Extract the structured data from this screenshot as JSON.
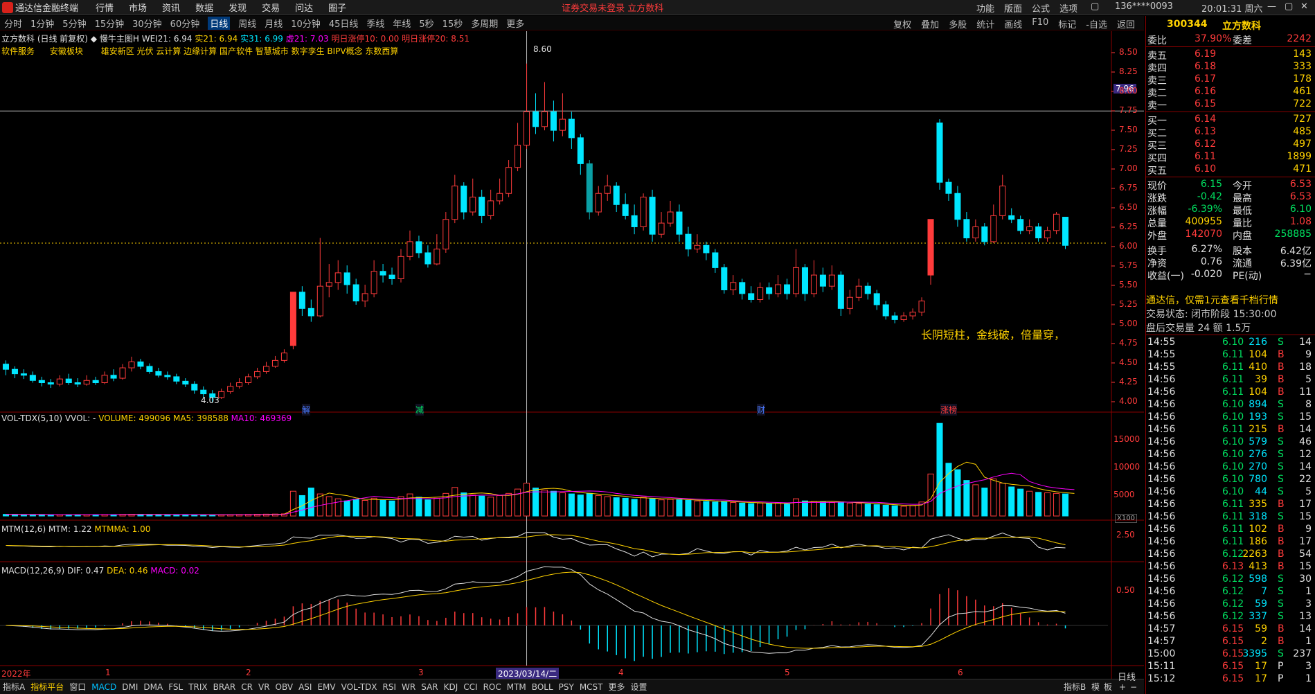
{
  "window": {
    "title": "通达信金融终端",
    "menu": [
      "行情",
      "市场",
      "资讯",
      "数据",
      "发现",
      "交易",
      "问达",
      "圈子"
    ],
    "notice": "证券交易未登录  立方数科",
    "right_menu": [
      "功能",
      "版面",
      "公式",
      "选项"
    ],
    "account": "136****0093",
    "clock": "20:01:31 周六"
  },
  "periods": [
    "分时",
    "1分钟",
    "5分钟",
    "15分钟",
    "30分钟",
    "60分钟",
    "日线",
    "周线",
    "月线",
    "10分钟",
    "45日线",
    "季线",
    "年线",
    "5秒",
    "15秒",
    "多周期",
    "更多"
  ],
  "active_period": "日线",
  "tools": [
    "复权",
    "叠加",
    "多股",
    "统计",
    "画线",
    "F10",
    "标记",
    "-自选",
    "返回"
  ],
  "main": {
    "legend": [
      {
        "t": "立方数科 (日线 前复权)",
        "c": "#e0e0e0"
      },
      {
        "t": "◆ 慢牛主图H",
        "c": "#e0e0e0"
      },
      {
        "t": "WEI21: 6.94",
        "c": "#e0e0e0"
      },
      {
        "t": "实21: 6.94",
        "c": "#ffd200"
      },
      {
        "t": "实31: 6.99",
        "c": "#00e6ff"
      },
      {
        "t": "虚21: 7.03",
        "c": "#ff00ff"
      },
      {
        "t": "明日涨停10: 0.00",
        "c": "#ff3b3b"
      },
      {
        "t": "明日涨停20: 8.51",
        "c": "#ff3b3b"
      }
    ],
    "tags_left": [
      "软件服务",
      "安徽板块"
    ],
    "tags": "雄安新区 光伏 云计算 边缘计算 国产软件 智慧城市 数字孪生 BIPV概念 东数西算",
    "crosshair_price": "7.96",
    "hi_label": "8.60",
    "lo_label": "4.03",
    "annotation": "长阴短柱，金线破，倍量穿，",
    "events": [
      "解",
      "减",
      "财",
      "涨榜"
    ]
  },
  "price_axis": [
    "8.50",
    "8.25",
    "8.00",
    "7.75",
    "7.50",
    "7.25",
    "7.00",
    "6.75",
    "6.50",
    "6.25",
    "6.00",
    "5.75",
    "5.50",
    "5.25",
    "5.00",
    "4.75",
    "4.50",
    "4.25",
    "4.00"
  ],
  "vol": {
    "legend": [
      {
        "t": "VOL-TDX(5,10)",
        "c": "#e0e0e0"
      },
      {
        "t": "VVOL: -",
        "c": "#e0e0e0"
      },
      {
        "t": "VOLUME: 499096",
        "c": "#ffd200"
      },
      {
        "t": "MA5: 398588",
        "c": "#ffd200"
      },
      {
        "t": "MA10: 469369",
        "c": "#ff00ff"
      }
    ],
    "axis": [
      "15000",
      "10000",
      "5000"
    ],
    "unit": "X100"
  },
  "mtm": {
    "legend": [
      {
        "t": "MTM(12,6)",
        "c": "#e0e0e0"
      },
      {
        "t": "MTM: 1.22",
        "c": "#e0e0e0"
      },
      {
        "t": "MTMMA: 1.00",
        "c": "#ffd200"
      }
    ],
    "axis": [
      "2.50"
    ]
  },
  "macd": {
    "legend": [
      {
        "t": "MACD(12,26,9)",
        "c": "#e0e0e0"
      },
      {
        "t": "DIF: 0.47",
        "c": "#e0e0e0"
      },
      {
        "t": "DEA: 0.46",
        "c": "#ffd200"
      },
      {
        "t": "MACD: 0.02",
        "c": "#ff00ff"
      }
    ],
    "axis": [
      "0.50"
    ]
  },
  "date_axis": [
    {
      "t": "2022年"
    },
    {
      "t": "1"
    },
    {
      "t": "2"
    },
    {
      "t": "3"
    },
    {
      "t": "2023/03/14/二"
    },
    {
      "t": "4"
    },
    {
      "t": "5"
    },
    {
      "t": "6"
    }
  ],
  "bottom_tabs": [
    "指标A",
    "指标平台",
    "窗口",
    "MACD",
    "DMI",
    "DMA",
    "FSL",
    "TRIX",
    "BRAR",
    "CR",
    "VR",
    "OBV",
    "ASI",
    "EMV",
    "VOL-TDX",
    "RSI",
    "WR",
    "SAR",
    "KDJ",
    "CCI",
    "ROC",
    "MTM",
    "BOLL",
    "PSY",
    "MCST",
    "更多",
    "设置"
  ],
  "active_tab": "MACD",
  "bottom_right": [
    "日线",
    "指标B",
    "模",
    "板"
  ],
  "quote": {
    "code": "300344",
    "name": "立方数科",
    "wb": "37.90%",
    "wc": "2242",
    "asks": [
      {
        "n": "卖五",
        "p": "6.19",
        "v": "143"
      },
      {
        "n": "卖四",
        "p": "6.18",
        "v": "333"
      },
      {
        "n": "卖三",
        "p": "6.17",
        "v": "178"
      },
      {
        "n": "卖二",
        "p": "6.16",
        "v": "461"
      },
      {
        "n": "卖一",
        "p": "6.15",
        "v": "722"
      }
    ],
    "bids": [
      {
        "n": "买一",
        "p": "6.14",
        "v": "727"
      },
      {
        "n": "买二",
        "p": "6.13",
        "v": "485"
      },
      {
        "n": "买三",
        "p": "6.12",
        "v": "497"
      },
      {
        "n": "买四",
        "p": "6.11",
        "v": "1899"
      },
      {
        "n": "买五",
        "p": "6.10",
        "v": "471"
      }
    ],
    "stats": [
      {
        "a": "现价",
        "b": "6.15",
        "bc": "grn",
        "c": "今开",
        "d": "6.53",
        "dc": "red"
      },
      {
        "a": "涨跌",
        "b": "-0.42",
        "bc": "grn",
        "c": "最高",
        "d": "6.53",
        "dc": "red"
      },
      {
        "a": "涨幅",
        "b": "-6.39%",
        "bc": "grn",
        "c": "最低",
        "d": "6.10",
        "dc": "grn"
      },
      {
        "a": "总量",
        "b": "400955",
        "bc": "yel",
        "c": "量比",
        "d": "1.08",
        "dc": "red"
      },
      {
        "a": "外盘",
        "b": "142070",
        "bc": "red",
        "c": "内盘",
        "d": "258885",
        "dc": "grn"
      },
      {
        "a": "换手",
        "b": "6.27%",
        "bc": "wht",
        "c": "股本",
        "d": "6.42亿",
        "dc": "wht"
      },
      {
        "a": "净资",
        "b": "0.76",
        "bc": "wht",
        "c": "流通",
        "d": "6.39亿",
        "dc": "wht"
      },
      {
        "a": "收益(一)",
        "b": "-0.020",
        "bc": "wht",
        "c": "PE(动)",
        "d": "−",
        "dc": "wht"
      }
    ],
    "ad": "通达信，仅需1元查看千档行情",
    "status": "交易状态: 闭市阶段 15:30:00",
    "after": "盘后交易量 24 额 1.5万",
    "ticks": [
      [
        "14:55",
        "6.10",
        "216",
        "S",
        "14"
      ],
      [
        "14:55",
        "6.11",
        "104",
        "B",
        "9"
      ],
      [
        "14:55",
        "6.11",
        "410",
        "B",
        "18"
      ],
      [
        "14:56",
        "6.11",
        "39",
        "B",
        "5"
      ],
      [
        "14:56",
        "6.11",
        "104",
        "B",
        "11"
      ],
      [
        "14:56",
        "6.10",
        "894",
        "S",
        "8"
      ],
      [
        "14:56",
        "6.10",
        "193",
        "S",
        "15"
      ],
      [
        "14:56",
        "6.11",
        "215",
        "B",
        "14"
      ],
      [
        "14:56",
        "6.10",
        "579",
        "S",
        "46"
      ],
      [
        "14:56",
        "6.10",
        "276",
        "S",
        "12"
      ],
      [
        "14:56",
        "6.10",
        "270",
        "S",
        "14"
      ],
      [
        "14:56",
        "6.10",
        "780",
        "S",
        "22"
      ],
      [
        "14:56",
        "6.10",
        "44",
        "S",
        "5"
      ],
      [
        "14:56",
        "6.11",
        "335",
        "B",
        "17"
      ],
      [
        "14:56",
        "6.11",
        "318",
        "S",
        "15"
      ],
      [
        "14:56",
        "6.11",
        "102",
        "B",
        "9"
      ],
      [
        "14:56",
        "6.11",
        "186",
        "B",
        "17"
      ],
      [
        "14:56",
        "6.12",
        "2263",
        "B",
        "54"
      ],
      [
        "14:56",
        "6.13",
        "413",
        "B",
        "15"
      ],
      [
        "14:56",
        "6.12",
        "598",
        "S",
        "30"
      ],
      [
        "14:56",
        "6.12",
        "7",
        "S",
        "1"
      ],
      [
        "14:56",
        "6.12",
        "59",
        "S",
        "3"
      ],
      [
        "14:56",
        "6.12",
        "337",
        "S",
        "13"
      ],
      [
        "14:57",
        "6.15",
        "59",
        "B",
        "14"
      ],
      [
        "14:57",
        "6.15",
        "2",
        "B",
        "1"
      ],
      [
        "15:00",
        "6.15",
        "3395",
        "S",
        "237"
      ],
      [
        "15:11",
        "6.15",
        "17",
        "P",
        "3"
      ],
      [
        "15:12",
        "6.15",
        "17",
        "P",
        "1"
      ]
    ]
  },
  "chart_data": {
    "type": "candlestick",
    "x_range": [
      "2022年12月",
      "2023年6月"
    ],
    "y_range": [
      4.0,
      8.6
    ],
    "high": 8.6,
    "low": 4.03,
    "candles": [
      [
        4.55,
        4.48,
        4.6,
        4.4
      ],
      [
        4.48,
        4.42,
        4.52,
        4.36
      ],
      [
        4.42,
        4.4,
        4.48,
        4.35
      ],
      [
        4.4,
        4.33,
        4.45,
        4.3
      ],
      [
        4.33,
        4.3,
        4.38,
        4.25
      ],
      [
        4.3,
        4.28,
        4.35,
        4.23
      ],
      [
        4.28,
        4.35,
        4.4,
        4.25
      ],
      [
        4.35,
        4.3,
        4.42,
        4.27
      ],
      [
        4.3,
        4.28,
        4.36,
        4.24
      ],
      [
        4.28,
        4.33,
        4.4,
        4.26
      ],
      [
        4.33,
        4.3,
        4.38,
        4.27
      ],
      [
        4.3,
        4.4,
        4.45,
        4.28
      ],
      [
        4.4,
        4.36,
        4.48,
        4.32
      ],
      [
        4.36,
        4.5,
        4.55,
        4.34
      ],
      [
        4.5,
        4.58,
        4.65,
        4.45
      ],
      [
        4.58,
        4.52,
        4.62,
        4.48
      ],
      [
        4.52,
        4.45,
        4.56,
        4.42
      ],
      [
        4.45,
        4.4,
        4.5,
        4.37
      ],
      [
        4.4,
        4.38,
        4.45,
        4.34
      ],
      [
        4.38,
        4.32,
        4.42,
        4.28
      ],
      [
        4.32,
        4.28,
        4.36,
        4.24
      ],
      [
        4.28,
        4.2,
        4.32,
        4.15
      ],
      [
        4.2,
        4.15,
        4.25,
        4.1
      ],
      [
        4.15,
        4.1,
        4.2,
        4.03
      ],
      [
        4.1,
        4.18,
        4.22,
        4.08
      ],
      [
        4.18,
        4.25,
        4.3,
        4.15
      ],
      [
        4.25,
        4.3,
        4.36,
        4.22
      ],
      [
        4.3,
        4.38,
        4.42,
        4.27
      ],
      [
        4.38,
        4.45,
        4.5,
        4.35
      ],
      [
        4.45,
        4.52,
        4.58,
        4.42
      ],
      [
        4.52,
        4.6,
        4.66,
        4.5
      ],
      [
        4.6,
        4.7,
        4.75,
        4.57
      ],
      [
        4.8,
        5.52,
        5.52,
        4.75
      ],
      [
        5.52,
        5.3,
        5.6,
        5.2
      ],
      [
        5.3,
        5.2,
        5.42,
        5.12
      ],
      [
        5.2,
        5.6,
        6.25,
        5.18
      ],
      [
        5.6,
        5.65,
        5.9,
        5.45
      ],
      [
        5.65,
        5.78,
        5.95,
        5.55
      ],
      [
        5.78,
        5.62,
        5.88,
        5.5
      ],
      [
        5.62,
        5.4,
        5.7,
        5.35
      ],
      [
        5.4,
        5.5,
        5.62,
        5.32
      ],
      [
        5.5,
        5.8,
        5.95,
        5.45
      ],
      [
        5.8,
        5.75,
        5.9,
        5.65
      ],
      [
        5.75,
        5.7,
        5.85,
        5.62
      ],
      [
        5.7,
        6.0,
        6.1,
        5.65
      ],
      [
        6.0,
        6.2,
        6.35,
        5.95
      ],
      [
        6.2,
        6.05,
        6.28,
        5.98
      ],
      [
        6.05,
        5.9,
        6.15,
        5.85
      ],
      [
        5.9,
        6.1,
        6.3,
        5.88
      ],
      [
        6.1,
        6.5,
        6.6,
        6.05
      ],
      [
        6.5,
        6.95,
        7.1,
        6.45
      ],
      [
        6.95,
        6.6,
        7.0,
        6.5
      ],
      [
        6.6,
        6.8,
        7.05,
        6.55
      ],
      [
        6.8,
        6.55,
        6.9,
        6.45
      ],
      [
        6.55,
        6.75,
        6.9,
        6.5
      ],
      [
        6.75,
        6.85,
        7.05,
        6.7
      ],
      [
        6.85,
        7.2,
        7.3,
        6.8
      ],
      [
        7.2,
        7.5,
        7.8,
        7.15
      ],
      [
        7.5,
        7.95,
        8.6,
        7.45
      ],
      [
        7.95,
        7.75,
        8.2,
        7.65
      ],
      [
        7.75,
        7.95,
        8.35,
        7.7
      ],
      [
        7.95,
        7.7,
        8.1,
        7.55
      ],
      [
        7.7,
        7.85,
        8.2,
        7.62
      ],
      [
        7.85,
        7.6,
        7.95,
        7.45
      ],
      [
        7.6,
        7.25,
        7.65,
        7.1
      ],
      [
        7.25,
        6.6,
        7.3,
        6.5
      ],
      [
        6.6,
        6.85,
        6.95,
        6.55
      ],
      [
        6.85,
        6.95,
        7.1,
        6.75
      ],
      [
        6.95,
        6.7,
        7.0,
        6.6
      ],
      [
        6.7,
        6.55,
        6.85,
        6.5
      ],
      [
        6.55,
        6.4,
        6.7,
        6.3
      ],
      [
        6.4,
        6.8,
        6.85,
        6.35
      ],
      [
        6.8,
        6.3,
        6.9,
        6.2
      ],
      [
        6.3,
        6.45,
        6.6,
        6.25
      ],
      [
        6.45,
        6.6,
        6.75,
        6.4
      ],
      [
        6.6,
        6.3,
        6.7,
        6.2
      ],
      [
        6.3,
        6.1,
        6.4,
        6.0
      ],
      [
        6.1,
        6.15,
        6.3,
        6.05
      ],
      [
        6.15,
        6.05,
        6.2,
        5.95
      ],
      [
        6.05,
        5.85,
        6.1,
        5.78
      ],
      [
        5.85,
        5.55,
        5.9,
        5.5
      ],
      [
        5.55,
        5.65,
        5.75,
        5.48
      ],
      [
        5.65,
        5.5,
        5.7,
        5.42
      ],
      [
        5.5,
        5.42,
        5.6,
        5.38
      ],
      [
        5.42,
        5.58,
        5.65,
        5.38
      ],
      [
        5.58,
        5.5,
        5.65,
        5.42
      ],
      [
        5.5,
        5.62,
        5.75,
        5.45
      ],
      [
        5.62,
        5.5,
        5.7,
        5.42
      ],
      [
        5.5,
        5.85,
        6.1,
        5.45
      ],
      [
        5.85,
        5.5,
        5.9,
        5.4
      ],
      [
        5.5,
        5.75,
        5.95,
        5.45
      ],
      [
        5.75,
        5.6,
        5.85,
        5.52
      ],
      [
        5.6,
        5.75,
        5.88,
        5.55
      ],
      [
        5.75,
        5.3,
        5.8,
        5.2
      ],
      [
        5.3,
        5.45,
        5.55,
        5.22
      ],
      [
        5.45,
        5.6,
        5.7,
        5.4
      ],
      [
        5.6,
        5.5,
        5.65,
        5.42
      ],
      [
        5.5,
        5.35,
        5.55,
        5.28
      ],
      [
        5.35,
        5.2,
        5.4,
        5.15
      ],
      [
        5.2,
        5.15,
        5.25,
        5.1
      ],
      [
        5.15,
        5.2,
        5.25,
        5.12
      ],
      [
        5.2,
        5.25,
        5.3,
        5.15
      ],
      [
        5.25,
        5.4,
        5.45,
        5.2
      ],
      [
        5.75,
        6.5,
        6.5,
        5.62
      ],
      [
        7.8,
        7.0,
        7.85,
        6.9
      ],
      [
        7.0,
        6.85,
        7.05,
        6.75
      ],
      [
        6.85,
        6.5,
        6.95,
        6.4
      ],
      [
        6.5,
        6.25,
        6.6,
        6.2
      ],
      [
        6.25,
        6.4,
        6.5,
        6.2
      ],
      [
        6.4,
        6.2,
        6.45,
        6.15
      ],
      [
        6.2,
        6.55,
        6.7,
        6.18
      ],
      [
        6.55,
        6.95,
        7.1,
        6.5
      ],
      [
        6.55,
        6.5,
        6.65,
        6.45
      ],
      [
        6.5,
        6.35,
        6.55,
        6.3
      ],
      [
        6.35,
        6.4,
        6.5,
        6.3
      ],
      [
        6.4,
        6.25,
        6.45,
        6.2
      ],
      [
        6.25,
        6.35,
        6.4,
        6.2
      ],
      [
        6.35,
        6.57,
        6.6,
        6.3
      ],
      [
        6.53,
        6.15,
        6.53,
        6.1
      ]
    ],
    "volume": [
      300,
      280,
      260,
      250,
      240,
      230,
      260,
      250,
      240,
      260,
      250,
      280,
      260,
      300,
      320,
      290,
      270,
      260,
      250,
      240,
      230,
      220,
      210,
      200,
      230,
      260,
      280,
      300,
      320,
      340,
      360,
      400,
      4600,
      3800,
      5200,
      4100,
      3600,
      3200,
      2800,
      3100,
      2900,
      3300,
      3000,
      2800,
      3600,
      4100,
      3500,
      3000,
      3300,
      4200,
      5300,
      4300,
      3900,
      3700,
      3500,
      3800,
      4200,
      5000,
      6100,
      5200,
      4800,
      4600,
      4300,
      4100,
      3900,
      4200,
      3800,
      3600,
      3400,
      3300,
      3100,
      3500,
      3200,
      3000,
      3100,
      3000,
      2900,
      2800,
      2700,
      2600,
      2700,
      2500,
      2400,
      2300,
      2400,
      2300,
      2400,
      2200,
      3200,
      2800,
      2700,
      2600,
      2500,
      2600,
      2400,
      2300,
      2200,
      2100,
      2000,
      1900,
      1800,
      1900,
      2600,
      7800,
      17200,
      9800,
      8600,
      6600,
      5800,
      5200,
      6900,
      6100,
      5400,
      5000,
      4600,
      4400,
      4300,
      4200,
      4100,
      3990
    ]
  }
}
